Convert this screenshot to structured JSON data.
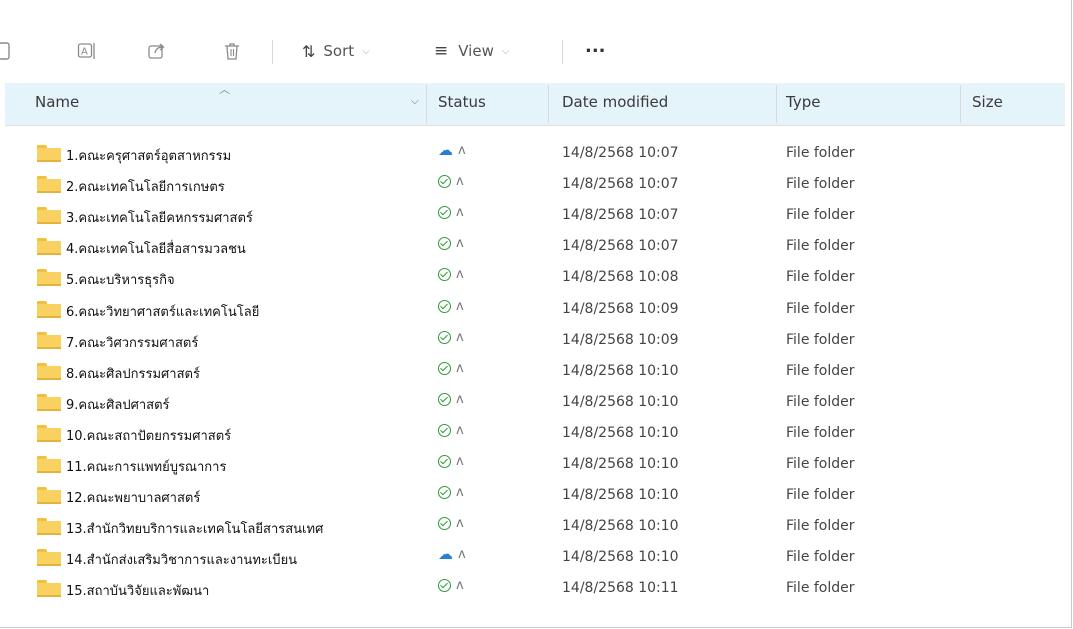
{
  "toolbar": {
    "sort_label": "Sort",
    "view_label": "View",
    "more_label": "..."
  },
  "columns": {
    "name": "Name",
    "status": "Status",
    "date": "Date modified",
    "type": "Type",
    "size": "Size"
  },
  "rows": [
    {
      "name": "1.คณะครุศาสตร์อุตสาหกรรม",
      "status": "cloud",
      "date": "14/8/2568 10:07",
      "type": "File folder"
    },
    {
      "name": "2.คณะเทคโนโลยีการเกษตร",
      "status": "ok",
      "date": "14/8/2568 10:07",
      "type": "File folder"
    },
    {
      "name": "3.คณะเทคโนโลยีคหกรรมศาสตร์",
      "status": "ok",
      "date": "14/8/2568 10:07",
      "type": "File folder"
    },
    {
      "name": "4.คณะเทคโนโลยีสื่อสารมวลชน",
      "status": "ok",
      "date": "14/8/2568 10:07",
      "type": "File folder"
    },
    {
      "name": "5.คณะบริหารธุรกิจ",
      "status": "ok",
      "date": "14/8/2568 10:08",
      "type": "File folder"
    },
    {
      "name": "6.คณะวิทยาศาสตร์และเทคโนโลยี",
      "status": "ok",
      "date": "14/8/2568 10:09",
      "type": "File folder"
    },
    {
      "name": "7.คณะวิศวกรรมศาสตร์",
      "status": "ok",
      "date": "14/8/2568 10:09",
      "type": "File folder"
    },
    {
      "name": "8.คณะศิลปกรรมศาสตร์",
      "status": "ok",
      "date": "14/8/2568 10:10",
      "type": "File folder"
    },
    {
      "name": "9.คณะศิลปศาสตร์",
      "status": "ok",
      "date": "14/8/2568 10:10",
      "type": "File folder"
    },
    {
      "name": "10.คณะสถาปัตยกรรมศาสตร์",
      "status": "ok",
      "date": "14/8/2568 10:10",
      "type": "File folder"
    },
    {
      "name": "11.คณะการแพทย์บูรณาการ",
      "status": "ok",
      "date": "14/8/2568 10:10",
      "type": "File folder"
    },
    {
      "name": "12.คณะพยาบาลศาสตร์",
      "status": "ok",
      "date": "14/8/2568 10:10",
      "type": "File folder"
    },
    {
      "name": "13.สำนักวิทยบริการและเทคโนโลยีสารสนเทศ",
      "status": "ok",
      "date": "14/8/2568 10:10",
      "type": "File folder"
    },
    {
      "name": "14.สำนักส่งเสริมวิชาการและงานทะเบียน",
      "status": "cloud",
      "date": "14/8/2568 10:10",
      "type": "File folder"
    },
    {
      "name": "15.สถาบันวิจัยและพัฒนา",
      "status": "ok",
      "date": "14/8/2568 10:11",
      "type": "File folder"
    }
  ],
  "icons": {
    "cut": "cut-icon",
    "rename": "rename-icon",
    "share": "share-icon",
    "delete": "delete-icon",
    "sort": "sort-icon",
    "view": "view-icon"
  },
  "colors": {
    "header_bg": "#e5f3fb",
    "folder": "#f8d160",
    "status_ok": "#2e9a3a",
    "status_cloud": "#2a7fd4"
  }
}
